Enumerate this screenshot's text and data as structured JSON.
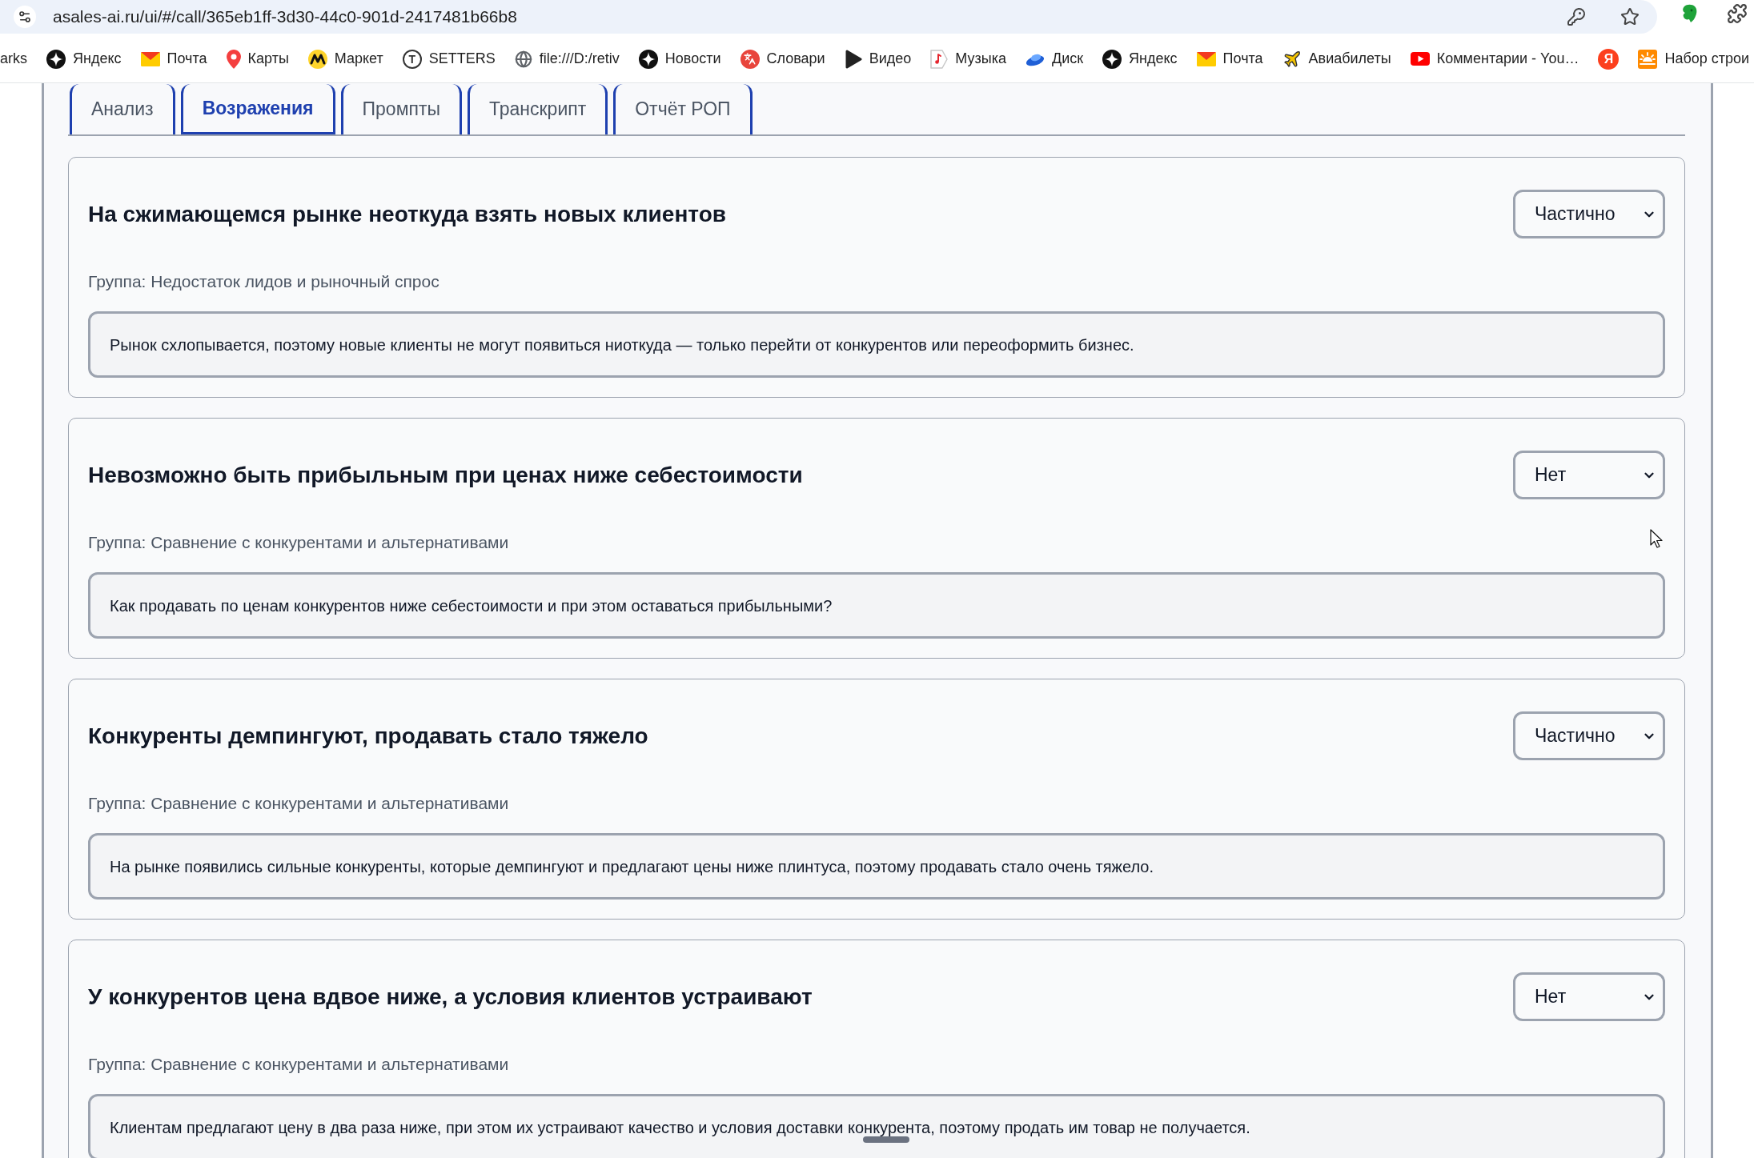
{
  "browser": {
    "url": "asales-ai.ru/ui/#/call/365eb1ff-3d30-44c0-901d-2417481b66b8"
  },
  "bookmarks": [
    {
      "kind": "none",
      "label": "arks"
    },
    {
      "kind": "sparkle",
      "label": "Яндекс"
    },
    {
      "kind": "mail",
      "label": "Почта"
    },
    {
      "kind": "pin",
      "label": "Карты"
    },
    {
      "kind": "market",
      "label": "Маркет"
    },
    {
      "kind": "circled",
      "glyph": "T",
      "label": "SETTERS"
    },
    {
      "kind": "globe",
      "label": "file:///D:/retiv"
    },
    {
      "kind": "sparkle",
      "label": "Новости"
    },
    {
      "kind": "translate",
      "label": "Словари"
    },
    {
      "kind": "video",
      "label": "Видео"
    },
    {
      "kind": "music",
      "label": "Музыка"
    },
    {
      "kind": "disk",
      "label": "Диск"
    },
    {
      "kind": "sparkle",
      "label": "Яндекс"
    },
    {
      "kind": "mail",
      "label": "Почта"
    },
    {
      "kind": "plane",
      "label": "Авиабилеты"
    },
    {
      "kind": "youtube",
      "label": "Комментарии - You…"
    },
    {
      "kind": "letter",
      "glyph": "Я"
    },
    {
      "kind": "sunrise",
      "label": "Набор строи"
    }
  ],
  "tabs": [
    {
      "label": "Анализ",
      "selected": false
    },
    {
      "label": "Возражения",
      "selected": true
    },
    {
      "label": "Промпты",
      "selected": false
    },
    {
      "label": "Транскрипт",
      "selected": false
    },
    {
      "label": "Отчёт РОП",
      "selected": false
    }
  ],
  "objections": [
    {
      "title": "На сжимающемся рынке неоткуда взять новых клиентов",
      "status": "Частично",
      "group": "Группа: Недостаток лидов и рыночный спрос",
      "text": "Рынок схлопывается, поэтому новые клиенты не могут появиться ниоткуда — только перейти от конкурентов или переоформить бизнес."
    },
    {
      "title": "Невозможно быть прибыльным при ценах ниже себестоимости",
      "status": "Нет",
      "group": "Группа: Сравнение с конкурентами и альтернативами",
      "text": "Как продавать по ценам конкурентов ниже себестоимости и при этом оставаться прибыльными?"
    },
    {
      "title": "Конкуренты демпингуют, продавать стало тяжело",
      "status": "Частично",
      "group": "Группа: Сравнение с конкурентами и альтернативами",
      "text": "На рынке появились сильные конкуренты, которые демпингуют и предлагают цены ниже плинтуса, поэтому продавать стало очень тяжело."
    },
    {
      "title": "У конкурентов цена вдвое ниже, а условия клиентов устраивают",
      "status": "Нет",
      "group": "Группа: Сравнение с конкурентами и альтернативами",
      "text": "Клиентам предлагают цену в два раза ниже, при этом их устраивают качество и условия доставки конкурента, поэтому продать им товар не получается."
    }
  ]
}
